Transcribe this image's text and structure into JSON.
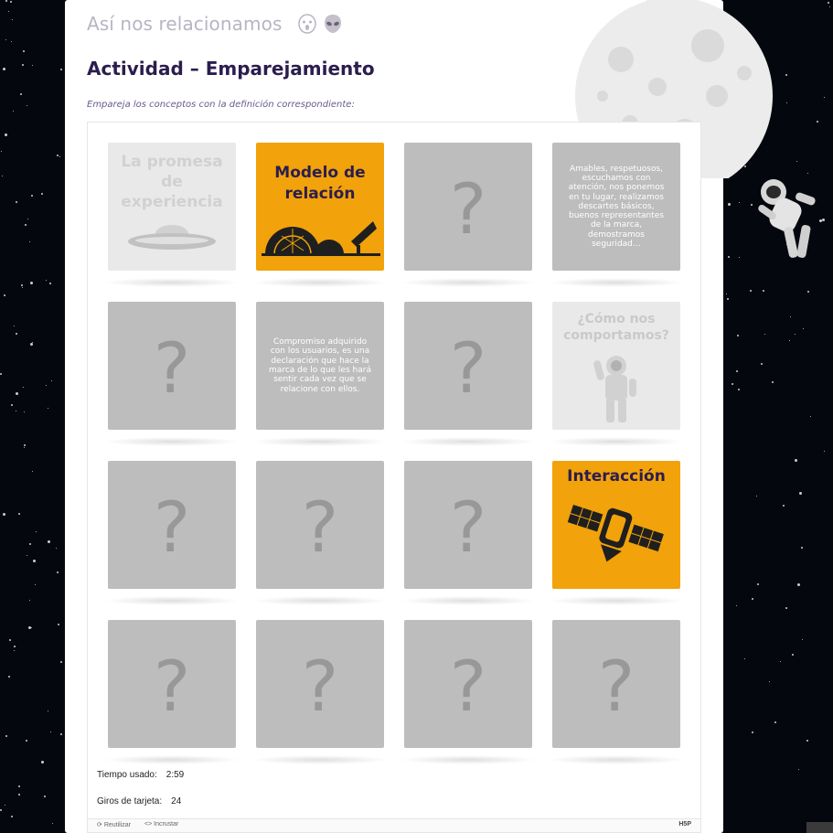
{
  "header": {
    "site_title": "Así nos relacionamos",
    "activity_title": "Actividad – Emparejamiento",
    "instruction": "Empareja los conceptos con la definición correspondiente:"
  },
  "cards": {
    "promesa_title": "La promesa de experiencia",
    "modelo_title": "Modelo de relación",
    "question_mark": "?",
    "comportamos_text": "Amables, respetuosos, escuchamos con atención, nos ponemos en tu lugar, realizamos descartes básicos, buenos representantes de la marca, demostramos seguridad…",
    "compromiso_text": "Compromiso adquirido con los usuarios, es una declaración que hace la marca de lo que les hará sentir cada vez que se relacione con ellos.",
    "como_title": "¿Cómo nos comportamos?",
    "interaccion_title": "Interacción"
  },
  "status": {
    "time_label": "Tiempo usado:",
    "time_value": "2:59",
    "flips_label": "Giros de tarjeta:",
    "flips_value": "24"
  },
  "footer": {
    "reuse_label": "Reutilizar",
    "embed_label": "Incrustar",
    "brand": "H5P"
  },
  "colors": {
    "card_back": "#bdbdbd",
    "card_orange": "#f2a20a",
    "title_purple": "#2b1d4e"
  }
}
